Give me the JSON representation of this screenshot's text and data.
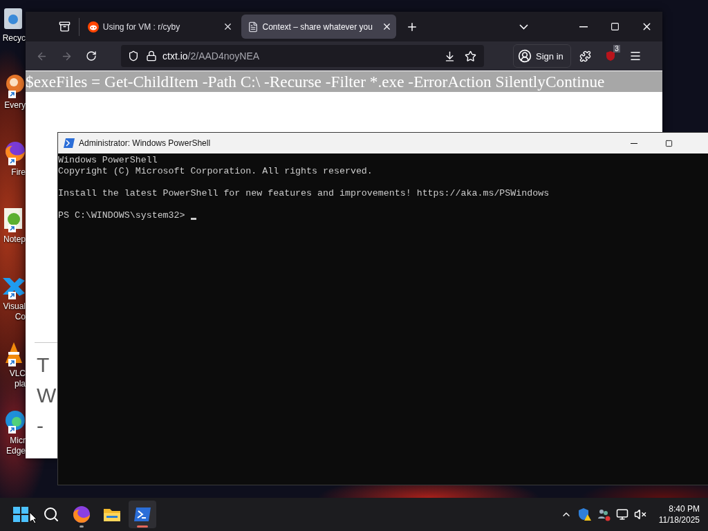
{
  "desktop_icons": [
    {
      "kind": "bin",
      "lines": [
        "Recyc"
      ],
      "shortcut": false
    },
    {
      "kind": "everything",
      "lines": [
        "Every"
      ],
      "shortcut": true
    },
    {
      "kind": "firefox",
      "lines": [
        "Fire"
      ],
      "shortcut": true
    },
    {
      "kind": "notepad",
      "lines": [
        "Notep"
      ],
      "shortcut": true
    },
    {
      "kind": "vscode",
      "lines": [
        "Visual",
        "Co"
      ],
      "shortcut": true
    },
    {
      "kind": "vlc",
      "lines": [
        "VLC",
        "pla"
      ],
      "shortcut": true
    },
    {
      "kind": "edge",
      "lines": [
        "Micr",
        "Edge"
      ],
      "shortcut": true
    }
  ],
  "browser": {
    "tabs": [
      {
        "kind": "reddit",
        "title": "Using for VM : r/cyby",
        "selected": false
      },
      {
        "kind": "document",
        "title": "Context – share whatever you",
        "selected": true
      }
    ],
    "url_domain": "ctxt.io",
    "url_path": "/2/AAD4noyNEA",
    "sign_in": "Sign in",
    "extension_badge": "3",
    "content": {
      "highlighted_line": "$exeFiles = Get-ChildItem -Path C:\\ -Recurse -Filter *.exe -ErrorAction SilentlyContinue",
      "fragments": [
        "T",
        "W",
        "-"
      ]
    }
  },
  "powershell": {
    "title": "Administrator: Windows PowerShell",
    "output": [
      [
        "Windows PowerShell",
        "Copyright (C) Microsoft Corporation. All rights reserved."
      ],
      [
        "Install the latest PowerShell for new features and improvements! https://aka.ms/PSWindows"
      ]
    ],
    "prompt": "PS C:\\WINDOWS\\system32>"
  },
  "taskbar": {
    "apps": [
      {
        "kind": "start",
        "running": false,
        "active": false
      },
      {
        "kind": "search",
        "running": false,
        "active": false
      },
      {
        "kind": "firefox",
        "running": true,
        "active": false
      },
      {
        "kind": "files",
        "running": false,
        "active": false
      },
      {
        "kind": "powershell",
        "running": true,
        "active": true
      }
    ],
    "time": "8:40 PM",
    "date": "11/18/2025"
  }
}
